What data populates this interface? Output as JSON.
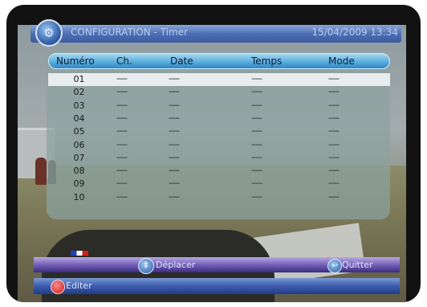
{
  "title": {
    "text": "CONFIGURATION -  Timer",
    "datetime": "15/04/2009  13:34",
    "icon": "configuration-icon"
  },
  "table": {
    "columns": [
      "Numéro",
      "Ch.",
      "Date",
      "Temps",
      "Mode"
    ],
    "rows": [
      {
        "num": "01",
        "ch": "-----",
        "date": "-----",
        "temps": "-----",
        "mode": "-----"
      },
      {
        "num": "02",
        "ch": "-----",
        "date": "-----",
        "temps": "-----",
        "mode": "-----"
      },
      {
        "num": "03",
        "ch": "-----",
        "date": "-----",
        "temps": "-----",
        "mode": "-----"
      },
      {
        "num": "04",
        "ch": "-----",
        "date": "-----",
        "temps": "-----",
        "mode": "-----"
      },
      {
        "num": "05",
        "ch": "-----",
        "date": "-----",
        "temps": "-----",
        "mode": "-----"
      },
      {
        "num": "06",
        "ch": "-----",
        "date": "-----",
        "temps": "-----",
        "mode": "-----"
      },
      {
        "num": "07",
        "ch": "-----",
        "date": "-----",
        "temps": "-----",
        "mode": "-----"
      },
      {
        "num": "08",
        "ch": "-----",
        "date": "-----",
        "temps": "-----",
        "mode": "-----"
      },
      {
        "num": "09",
        "ch": "-----",
        "date": "-----",
        "temps": "-----",
        "mode": "-----"
      },
      {
        "num": "10",
        "ch": "-----",
        "date": "-----",
        "temps": "-----",
        "mode": "-----"
      }
    ],
    "selected_row": "01"
  },
  "footer": {
    "move_label": "Déplacer",
    "quit_label": "Quitter",
    "edit_label": "Editer",
    "move_icon": "navigation-icon",
    "quit_icon": "exit-icon",
    "edit_icon": "red-button-icon"
  },
  "colors": {
    "title_bar": "#4d6fb4",
    "header_bar": "#5aaede",
    "selected_row": "#e8ecec",
    "footer_top": "#7460b8",
    "footer_bottom": "#3c5cac",
    "edit_button": "#c01c1c"
  }
}
